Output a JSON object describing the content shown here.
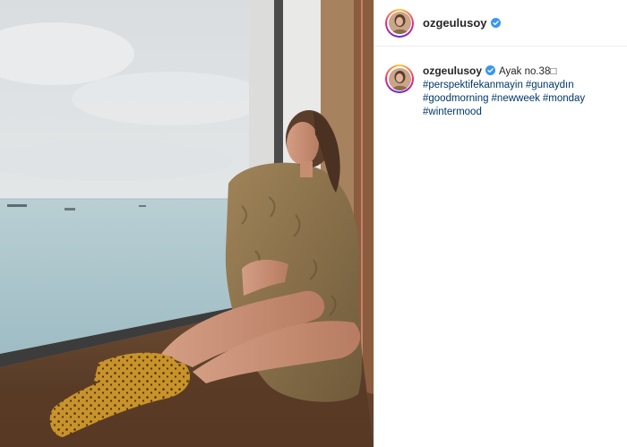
{
  "post": {
    "username": "ozgeulusoy",
    "verified": true,
    "caption": "Ayak no.38□",
    "hashtags": [
      "#perspektifekanmayin",
      "#gunaydın",
      "#goodmorning",
      "#newweek",
      "#monday",
      "#wintermood"
    ]
  },
  "icons": {
    "verified": "verified-badge-icon"
  },
  "colors": {
    "verified_blue": "#3897f0",
    "hashtag": "#00376b",
    "text": "#262626"
  }
}
